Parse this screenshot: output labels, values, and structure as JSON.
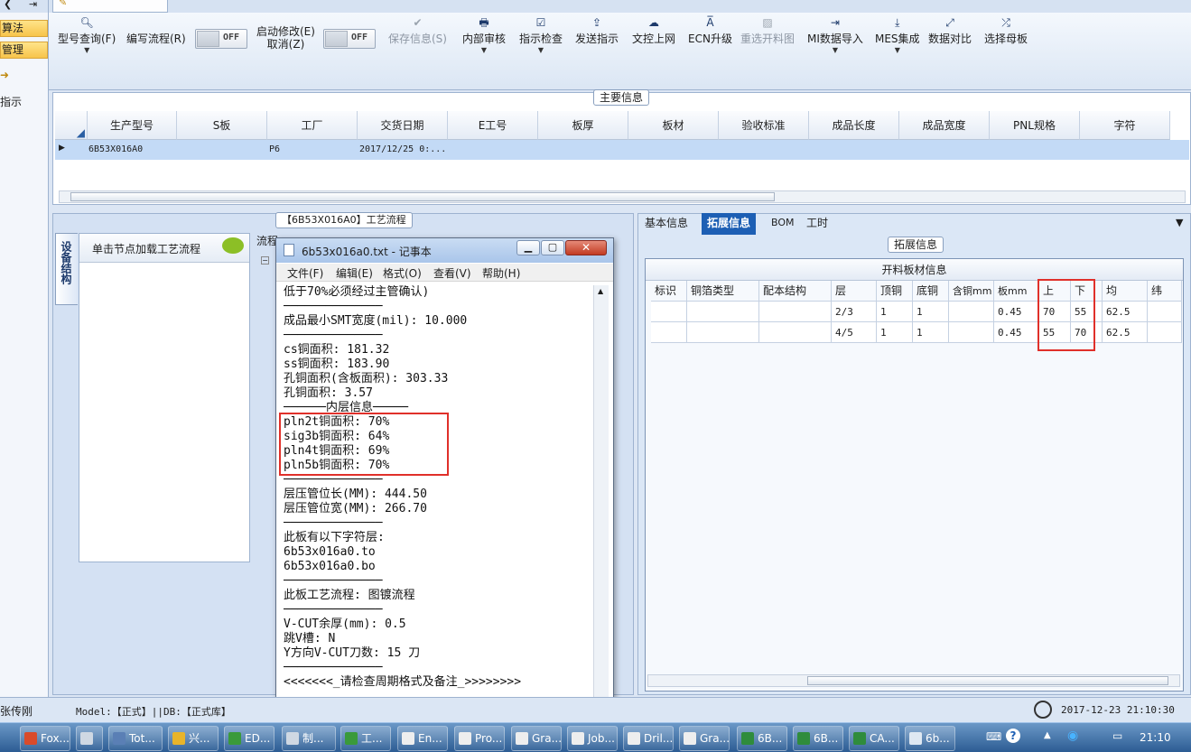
{
  "left_nav": {
    "item1": "算法",
    "item2": "管理",
    "item3": "指示"
  },
  "toolbar": {
    "model_query": "型号查询(F)",
    "write_flow": "编写流程(R)",
    "toggle1": "OFF",
    "start_modify": "启动修改(E)",
    "cancel": "取消(Z)",
    "toggle2": "OFF",
    "save_info": "保存信息(S)",
    "internal_review": "内部审核",
    "indicate_check": "指示检查",
    "send_indicate": "发送指示",
    "doc_upload": "文控上网",
    "ecn_upgrade": "ECN升级",
    "reselect_chart": "重选开料图",
    "mi_import": "MI数据导入",
    "mes_integration": "MES集成",
    "data_compare": "数据对比",
    "select_master": "选择母板"
  },
  "main_info": {
    "section_title": "主要信息",
    "columns": [
      "生产型号",
      "S板",
      "工厂",
      "交货日期",
      "E工号",
      "板厚",
      "板材",
      "验收标准",
      "成品长度",
      "成品宽度",
      "PNL规格",
      "字符"
    ],
    "row": {
      "model": "6B53X016A0",
      "factory": "P6",
      "date": "2017/12/25 0:..."
    }
  },
  "process": {
    "section_title": "【6B53X016A0】工艺流程",
    "vtab": "设备结构",
    "node_hint": "单击节点加载工艺流程",
    "col_header": "流程"
  },
  "right_tabs": {
    "basic": "基本信息",
    "extended": "拓展信息",
    "bom": "BOM",
    "hours": "工时"
  },
  "extended": {
    "section_title": "拓展信息",
    "table_title": "开料板材信息",
    "columns": [
      "标识",
      "铜箔类型",
      "配本结构",
      "层",
      "顶铜",
      "底铜",
      "含铜mm",
      "板mm",
      "上",
      "下",
      "均",
      "纬"
    ],
    "rows": [
      {
        "layer": "2/3",
        "top": "1",
        "bottom": "1",
        "board": "0.45",
        "up": "70",
        "down": "55",
        "avg": "62.5"
      },
      {
        "layer": "4/5",
        "top": "1",
        "bottom": "1",
        "board": "0.45",
        "up": "55",
        "down": "70",
        "avg": "62.5"
      }
    ]
  },
  "notepad": {
    "title": "6b53x016a0.txt - 记事本",
    "menu": [
      "文件(F)",
      "编辑(E)",
      "格式(O)",
      "查看(V)",
      "帮助(H)"
    ],
    "lines": [
      "低于70%必须经过主管确认)",
      "──────────────",
      "成品最小SMT宽度(mil): 10.000",
      "──────────────",
      "cs铜面积: 181.32",
      "ss铜面积: 183.90",
      "孔铜面积(含板面积): 303.33",
      "孔铜面积: 3.57",
      "──────内层信息─────",
      "pln2t铜面积: 70%",
      "sig3b铜面积: 64%",
      "pln4t铜面积: 69%",
      "pln5b铜面积: 70%",
      "──────────────",
      "层压管位长(MM): 444.50",
      "层压管位宽(MM): 266.70",
      "──────────────",
      "此板有以下字符层:",
      "6b53x016a0.to",
      "6b53x016a0.bo",
      "──────────────",
      "此板工艺流程: 图镀流程",
      "──────────────",
      "V-CUT余厚(mm): 0.5",
      "跳V槽: N",
      "Y方向V-CUT刀数: 15 刀",
      "──────────────",
      "<<<<<<<_请检查周期格式及备注_>>>>>>>>"
    ]
  },
  "status": {
    "user": "张传刚",
    "model_db": "Model:【正式】||DB:【正式库】",
    "datetime": "2017-12-23 21:10:30"
  },
  "taskbar": {
    "items": [
      "Fox...",
      "",
      "Tot...",
      "兴...",
      "ED...",
      "制...",
      "工...",
      "En...",
      "Pro...",
      "Gra...",
      "Job...",
      "Dril...",
      "Gra...",
      "6B...",
      "6B...",
      "CA...",
      "6b..."
    ],
    "clock": "21:10"
  },
  "colors": {
    "highlight_red": "#e0302a",
    "accent_blue": "#1d5fb4",
    "nav_yellow": "#f7c44a"
  }
}
